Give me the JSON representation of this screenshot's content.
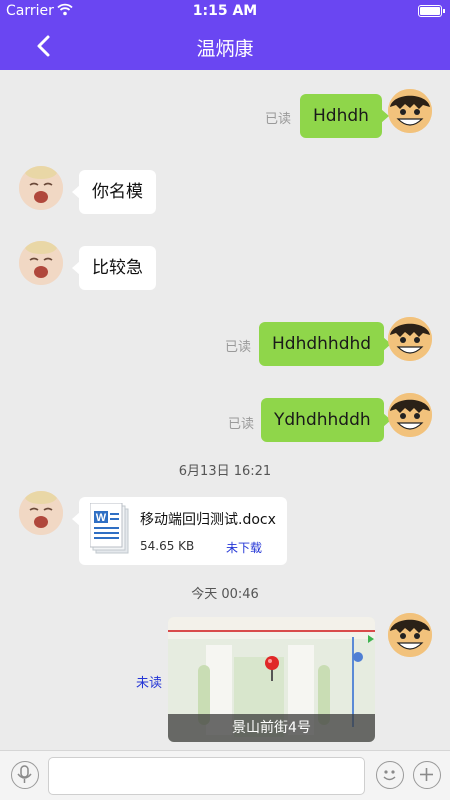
{
  "status_bar": {
    "carrier": "Carrier",
    "time": "1:15 AM"
  },
  "header": {
    "title": "温炳康"
  },
  "messages": [
    {
      "side": "me",
      "text": "Hdhdh",
      "receipt": "已读"
    },
    {
      "side": "other",
      "text": "你名模"
    },
    {
      "side": "other",
      "text": "比较急"
    },
    {
      "side": "me",
      "text": "Hdhdhhdhd",
      "receipt": "已读"
    },
    {
      "side": "me",
      "text": "Ydhdhhddh",
      "receipt": "已读"
    }
  ],
  "timestamps": [
    "6月13日  16:21",
    "今天  00:46"
  ],
  "file_message": {
    "file_name": "移动端回归测试.docx",
    "file_size": "54.65 KB",
    "download_status": "未下载"
  },
  "location_message": {
    "address": "景山前街4号",
    "receipt": "未读"
  },
  "colors": {
    "accent": "#6a46f2",
    "bubble_me": "#8fd64a",
    "unread": "#2436d6"
  }
}
